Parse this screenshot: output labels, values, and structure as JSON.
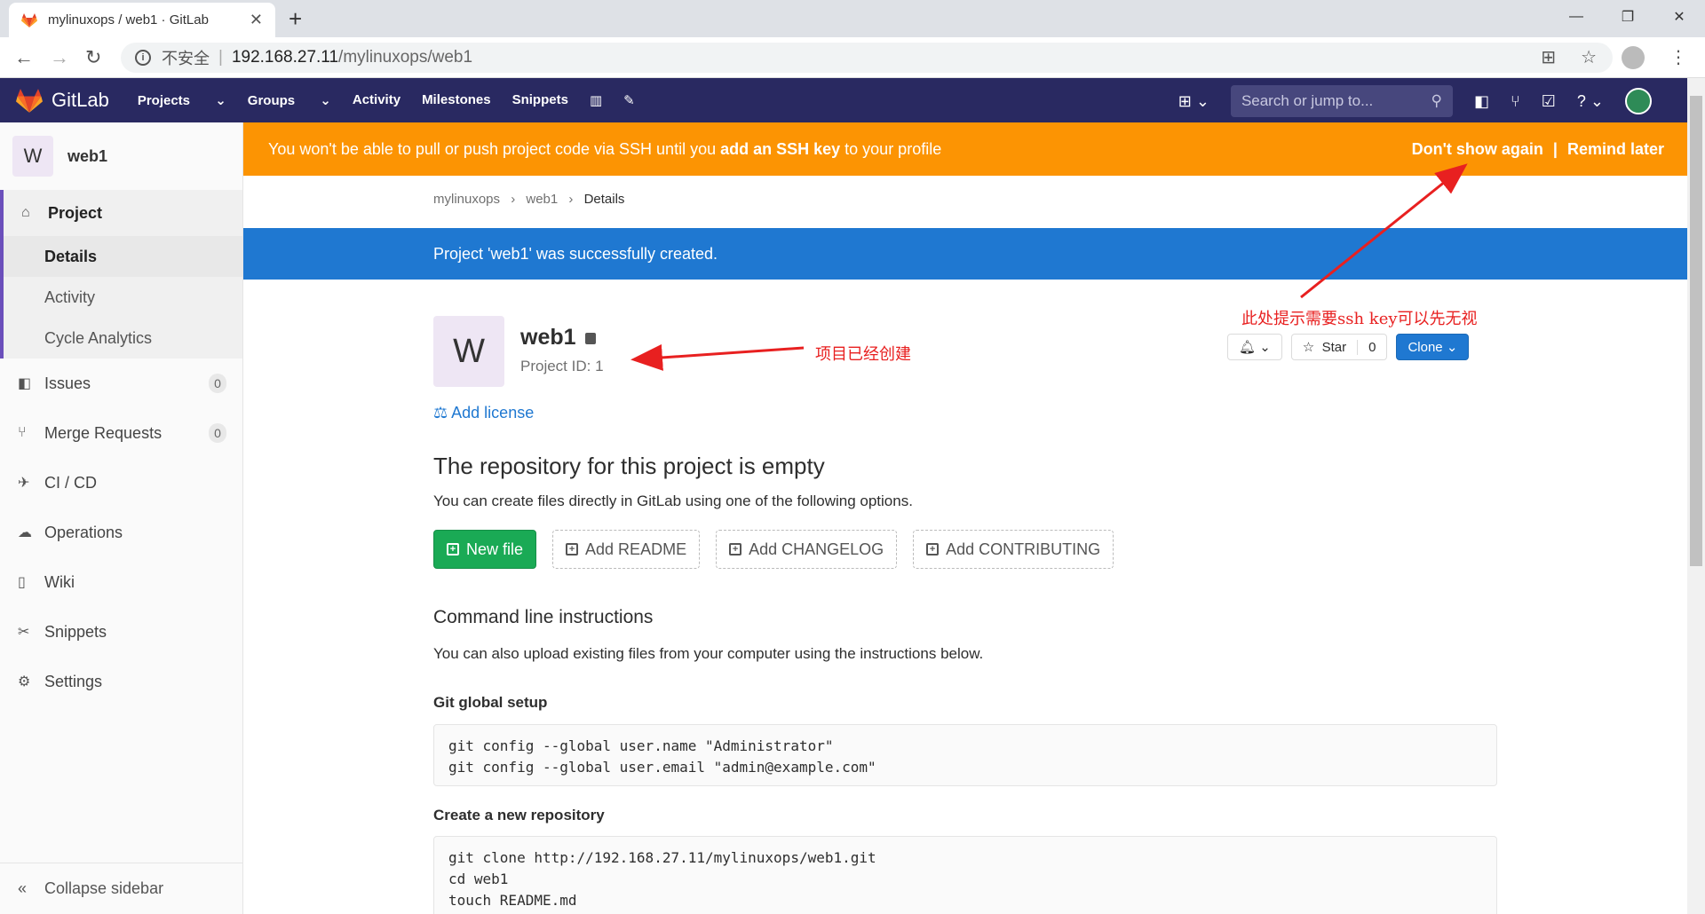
{
  "browser": {
    "tab_title": "mylinuxops / web1 · GitLab",
    "insecure_label": "不安全",
    "url_host": "192.168.27.11",
    "url_path": "/mylinuxops/web1"
  },
  "header": {
    "brand": "GitLab",
    "nav": [
      "Projects",
      "Groups",
      "Activity",
      "Milestones",
      "Snippets"
    ],
    "search_placeholder": "Search or jump to..."
  },
  "sidebar": {
    "project_initial": "W",
    "project_name": "web1",
    "section_label": "Project",
    "sub_items": [
      "Details",
      "Activity",
      "Cycle Analytics"
    ],
    "items": [
      {
        "label": "Issues",
        "count": "0"
      },
      {
        "label": "Merge Requests",
        "count": "0"
      },
      {
        "label": "CI / CD"
      },
      {
        "label": "Operations"
      },
      {
        "label": "Wiki"
      },
      {
        "label": "Snippets"
      },
      {
        "label": "Settings"
      }
    ],
    "collapse_label": "Collapse sidebar"
  },
  "ssh_banner": {
    "text_before": "You won't be able to pull or push project code via SSH until you ",
    "link": "add an SSH key",
    "text_after": " to your profile",
    "dont_show": "Don't show again",
    "separator": "|",
    "remind": "Remind later",
    "color": "#fc9403"
  },
  "breadcrumb": [
    "mylinuxops",
    "web1",
    "Details"
  ],
  "flash": "Project 'web1' was successfully created.",
  "project": {
    "initial": "W",
    "name": "web1",
    "id_label": "Project ID: 1",
    "star_label": "Star",
    "star_count": "0",
    "clone_label": "Clone",
    "add_license": "Add license"
  },
  "empty": {
    "title": "The repository for this project is empty",
    "desc": "You can create files directly in GitLab using one of the following options.",
    "buttons": [
      "New file",
      "Add README",
      "Add CHANGELOG",
      "Add CONTRIBUTING"
    ]
  },
  "cli": {
    "title": "Command line instructions",
    "desc": "You can also upload existing files from your computer using the instructions below.",
    "global_setup_title": "Git global setup",
    "global_setup_code": "git config --global user.name \"Administrator\"\ngit config --global user.email \"admin@example.com\"",
    "new_repo_title": "Create a new repository",
    "new_repo_code": "git clone http://192.168.27.11/mylinuxops/web1.git\ncd web1\ntouch README.md"
  },
  "annotations": {
    "created": "项目已经创建",
    "ssh_hint": "此处提示需要ssh key可以先无视",
    "color": "#e82020"
  }
}
